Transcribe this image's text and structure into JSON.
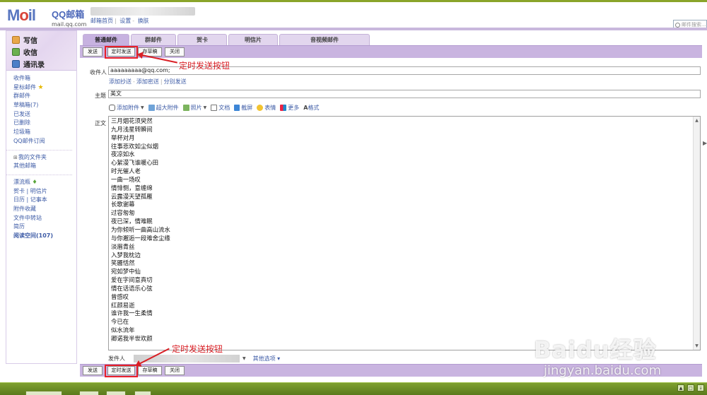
{
  "header": {
    "logo_text": "Mail",
    "brand_name": "QQ邮箱",
    "brand_domain": "mail.qq.com",
    "links": [
      "邮箱首页",
      "设置",
      "换肤"
    ],
    "search_placeholder": "邮件搜索..."
  },
  "sidebar": {
    "top": [
      {
        "label": "写信",
        "icon": "pencil-icon"
      },
      {
        "label": "收信",
        "icon": "inbox-icon"
      },
      {
        "label": "通讯录",
        "icon": "contacts-icon"
      }
    ],
    "folders": [
      "收件箱",
      "星标邮件",
      "群邮件",
      "草稿箱(7)",
      "已发送",
      "已删除",
      "垃圾箱",
      "QQ邮件订阅"
    ],
    "my_folders": "我的文件夹",
    "other_mailbox": "其他邮箱",
    "extras": [
      "漂流瓶",
      "贺卡",
      "明信片",
      "日历",
      "记事本",
      "附件收藏",
      "文件中转站",
      "简历",
      "阅读空间(107)"
    ]
  },
  "tabs": [
    "普通邮件",
    "群邮件",
    "贺卡",
    "明信片",
    "音视频邮件"
  ],
  "toolbar": {
    "send": "发送",
    "timed_send": "定时发送",
    "save_draft": "存草稿",
    "close": "关闭"
  },
  "form": {
    "recipient_label": "收件人",
    "recipient_value": "aaaaaaaaa@qq.com;",
    "cc_links": [
      "添加抄送",
      "添加密送",
      "分别发送"
    ],
    "subject_label": "主题",
    "subject_value": "美文",
    "body_label": "正文",
    "sender_label": "发件人",
    "other_options": "其他选项"
  },
  "attach_toolbar": [
    "添加附件",
    "超大附件",
    "照片",
    "文档",
    "截屏",
    "表情",
    "更多",
    "格式"
  ],
  "body_lines": [
    "三月烟花须臾然",
    "九月浅星转瞬间",
    "举杯对月",
    "往事悲欢如尘似烟",
    "夜凉如水",
    "心絮漫飞谁暖心田",
    "时光催人老",
    "一曲一场叹",
    "情悱恻，意缠绵",
    "云露漫天望孤雁",
    "长歌谢幕",
    "过容匆匆",
    "夜已深，情难眠",
    "为你倾听一曲高山流水",
    "与你邂逅一段难舍尘缘",
    "淡眉青丝",
    "入梦我枕边",
    "笑靥恬然",
    "宛如梦中仙",
    "爱在字间意真切",
    "情在话语乐心弦",
    "曾感叹",
    "红颜易逝",
    "谁许我一生柔情",
    "今已在",
    "似水流年",
    "卿诺我半世欢颜"
  ],
  "annotations": {
    "top": "定时发送按钮",
    "bottom": "定时发送按钮"
  },
  "watermark": {
    "line1": "Baidu经验",
    "line2": "jingyan.baidu.com"
  },
  "colors": {
    "accent_purple": "#c9b4e0",
    "link_blue": "#3d5ba6",
    "highlight_red": "#e8202a",
    "taskbar_green": "#6b8c22"
  }
}
